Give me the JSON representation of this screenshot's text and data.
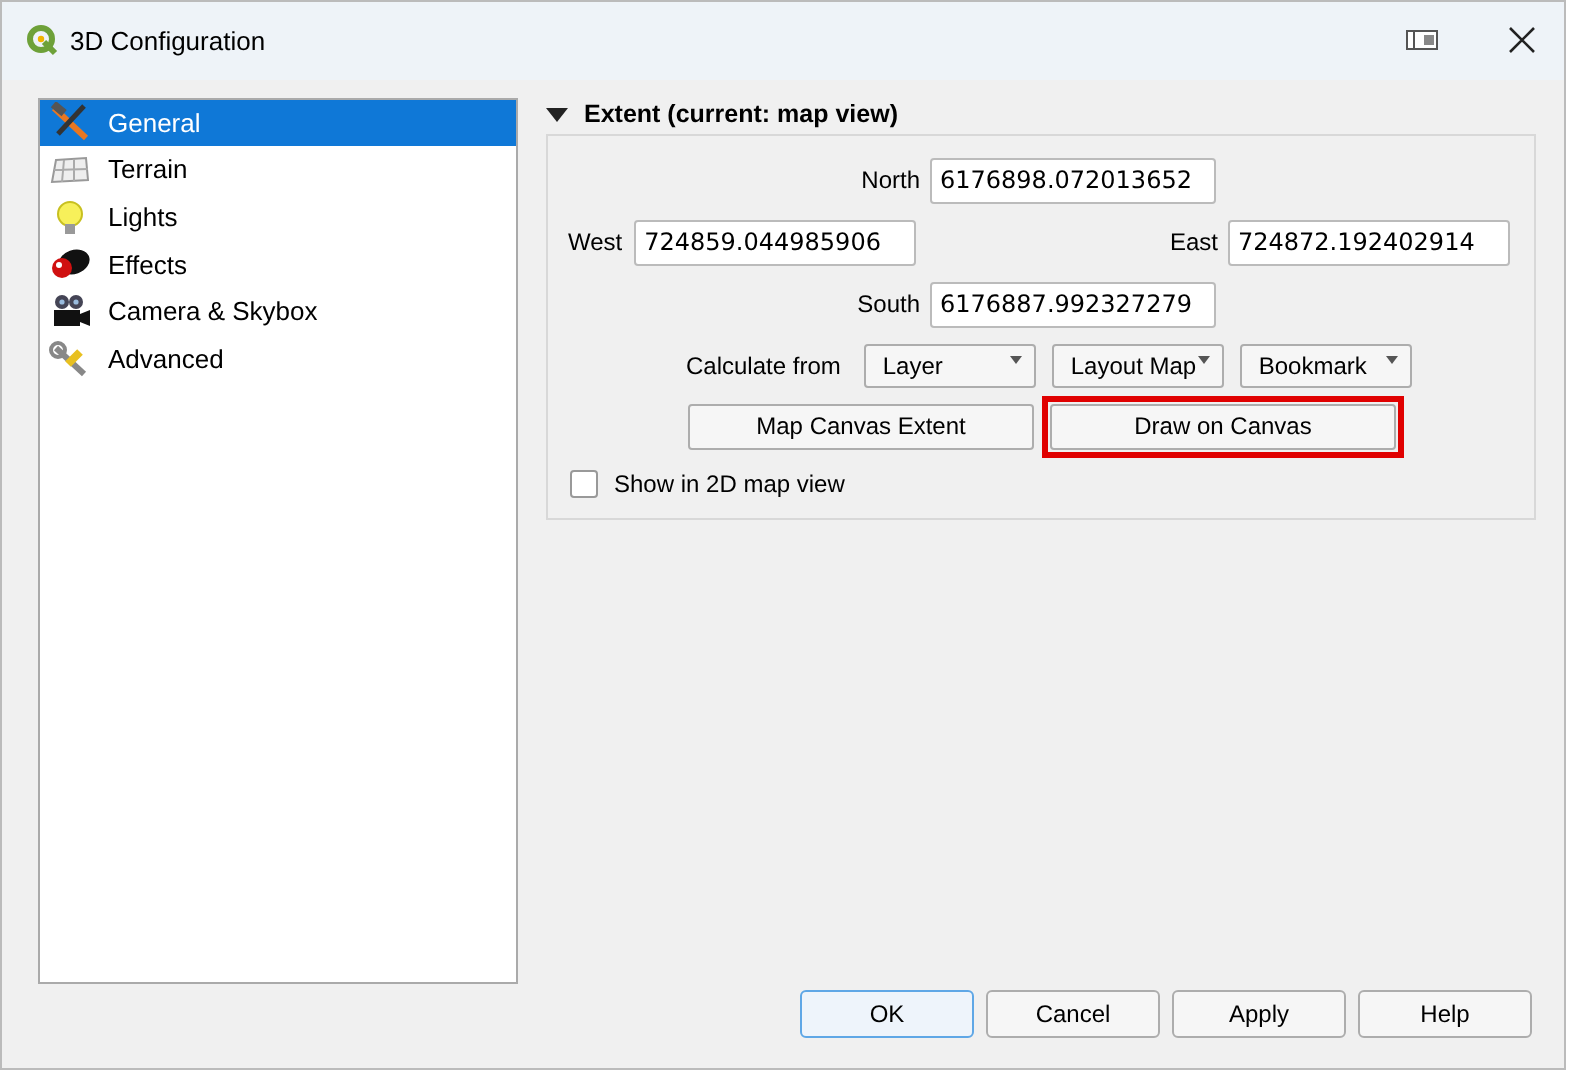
{
  "window": {
    "title": "3D Configuration"
  },
  "sidebar": {
    "items": [
      {
        "label": "General",
        "selected": true
      },
      {
        "label": "Terrain",
        "selected": false
      },
      {
        "label": "Lights",
        "selected": false
      },
      {
        "label": "Effects",
        "selected": false
      },
      {
        "label": "Camera & Skybox",
        "selected": false
      },
      {
        "label": "Advanced",
        "selected": false
      }
    ]
  },
  "extent_group": {
    "title": "Extent (current: map view)",
    "expanded": true,
    "north": {
      "label": "North",
      "value": "6176898.072013652"
    },
    "west": {
      "label": "West",
      "value": "724859.044985906"
    },
    "east": {
      "label": "East",
      "value": "724872.192402914"
    },
    "south": {
      "label": "South",
      "value": "6176887.992327279"
    },
    "calculate_label": "Calculate from",
    "calculate_buttons": [
      "Layer",
      "Layout Map",
      "Bookmark"
    ],
    "action_buttons": [
      {
        "label": "Map Canvas Extent",
        "highlighted": false
      },
      {
        "label": "Draw on Canvas",
        "highlighted": true
      }
    ],
    "show_in_2d": {
      "label": "Show in 2D map view",
      "checked": false
    }
  },
  "buttons": [
    {
      "label": "OK",
      "default": true
    },
    {
      "label": "Cancel",
      "default": false
    },
    {
      "label": "Apply",
      "default": false
    },
    {
      "label": "Help",
      "default": false
    }
  ]
}
